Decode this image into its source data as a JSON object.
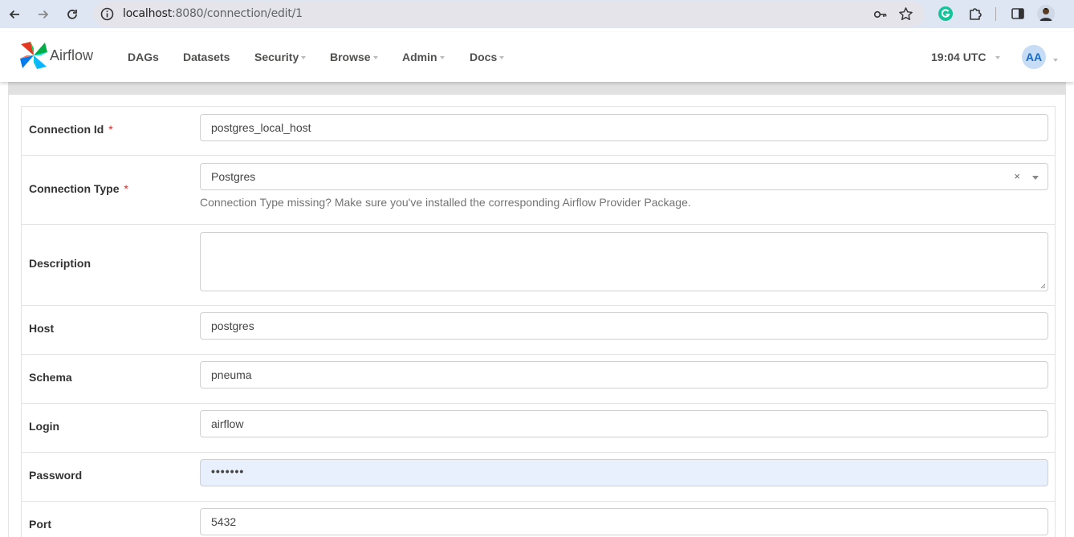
{
  "browser": {
    "url_host": "localhost",
    "url_rest": ":8080/connection/edit/1"
  },
  "app": {
    "brand": "Airflow",
    "menu": [
      {
        "label": "DAGs",
        "caret": false
      },
      {
        "label": "Datasets",
        "caret": false
      },
      {
        "label": "Security",
        "caret": true
      },
      {
        "label": "Browse",
        "caret": true
      },
      {
        "label": "Admin",
        "caret": true
      },
      {
        "label": "Docs",
        "caret": true
      }
    ],
    "clock": "19:04 UTC",
    "avatar_initials": "AA"
  },
  "form": {
    "required_mark": "*",
    "conn_id": {
      "label": "Connection Id",
      "value": "postgres_local_host"
    },
    "conn_type": {
      "label": "Connection Type",
      "value": "Postgres",
      "clear": "×",
      "help": "Connection Type missing? Make sure you've installed the corresponding Airflow Provider Package."
    },
    "description": {
      "label": "Description",
      "value": ""
    },
    "host": {
      "label": "Host",
      "value": "postgres"
    },
    "schema": {
      "label": "Schema",
      "value": "pneuma"
    },
    "login": {
      "label": "Login",
      "value": "airflow"
    },
    "password": {
      "label": "Password",
      "value": "•••••••"
    },
    "port": {
      "label": "Port",
      "value": "5432"
    }
  },
  "colors": {
    "required": "#c9302c",
    "autofill": "#e8f0fe",
    "avatar_bg": "#c7dcf5",
    "avatar_fg": "#1769c2",
    "chrome_bg": "#dfe6f3"
  }
}
